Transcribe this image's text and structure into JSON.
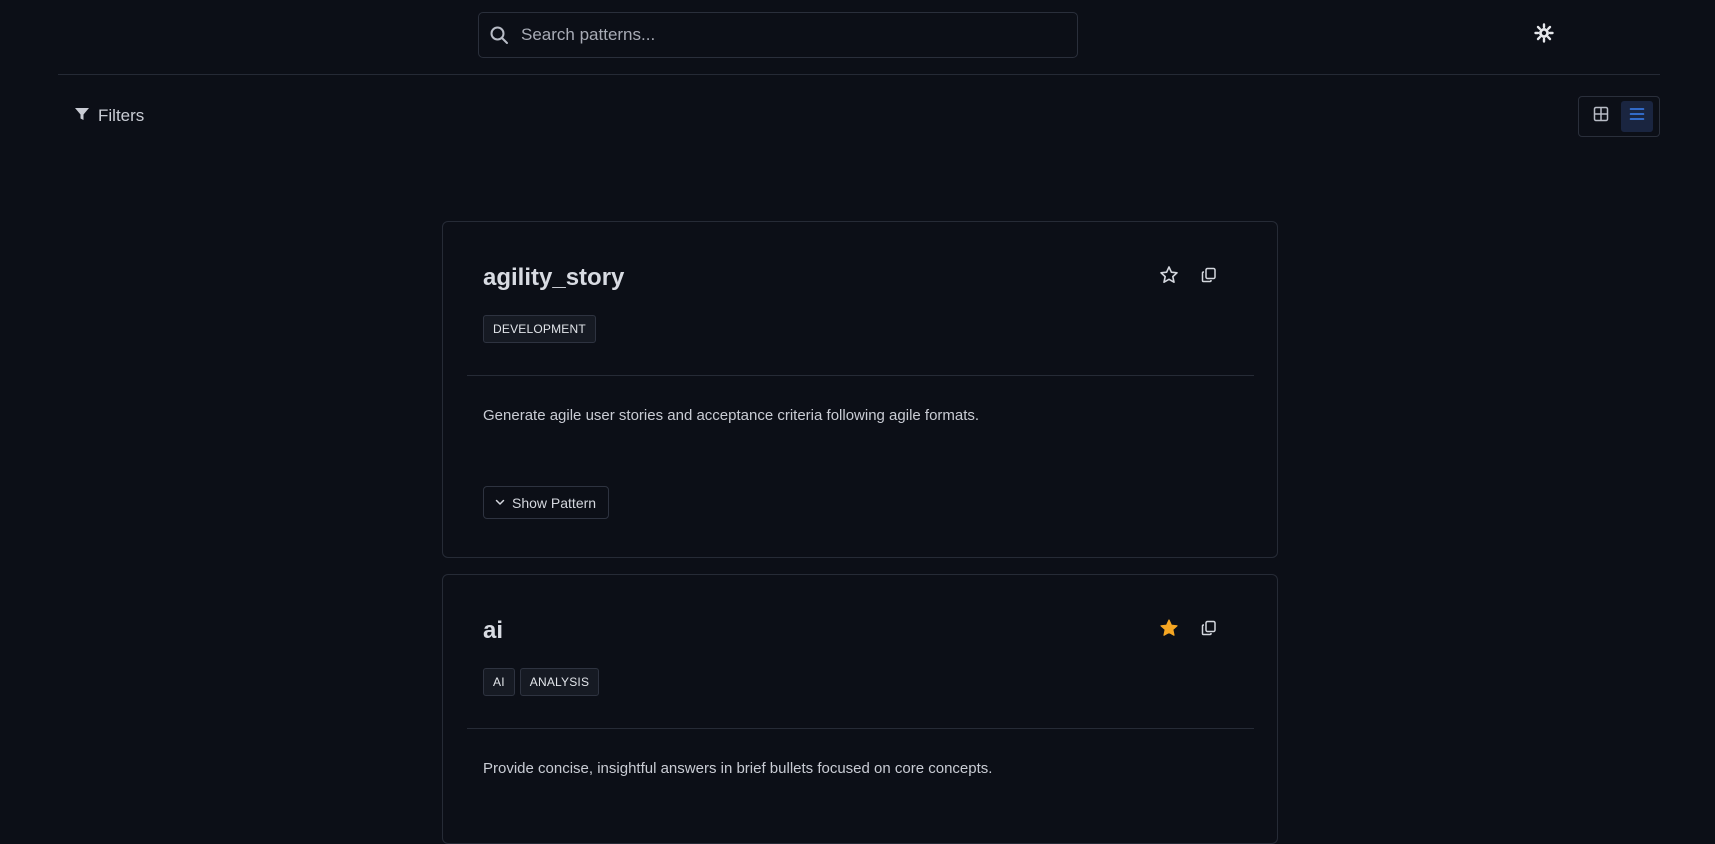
{
  "search": {
    "placeholder": "Search patterns..."
  },
  "toolbar": {
    "filters_label": "Filters"
  },
  "colors": {
    "accent": "#3b82f6",
    "star_active": "#f5a623",
    "background": "#0c0f17"
  },
  "patterns": [
    {
      "title": "agility_story",
      "tags": [
        "DEVELOPMENT"
      ],
      "description": "Generate agile user stories and acceptance criteria following agile formats.",
      "favorited": false,
      "show_label": "Show Pattern"
    },
    {
      "title": "ai",
      "tags": [
        "AI",
        "ANALYSIS"
      ],
      "description": "Provide concise, insightful answers in brief bullets focused on core concepts.",
      "favorited": true
    }
  ]
}
